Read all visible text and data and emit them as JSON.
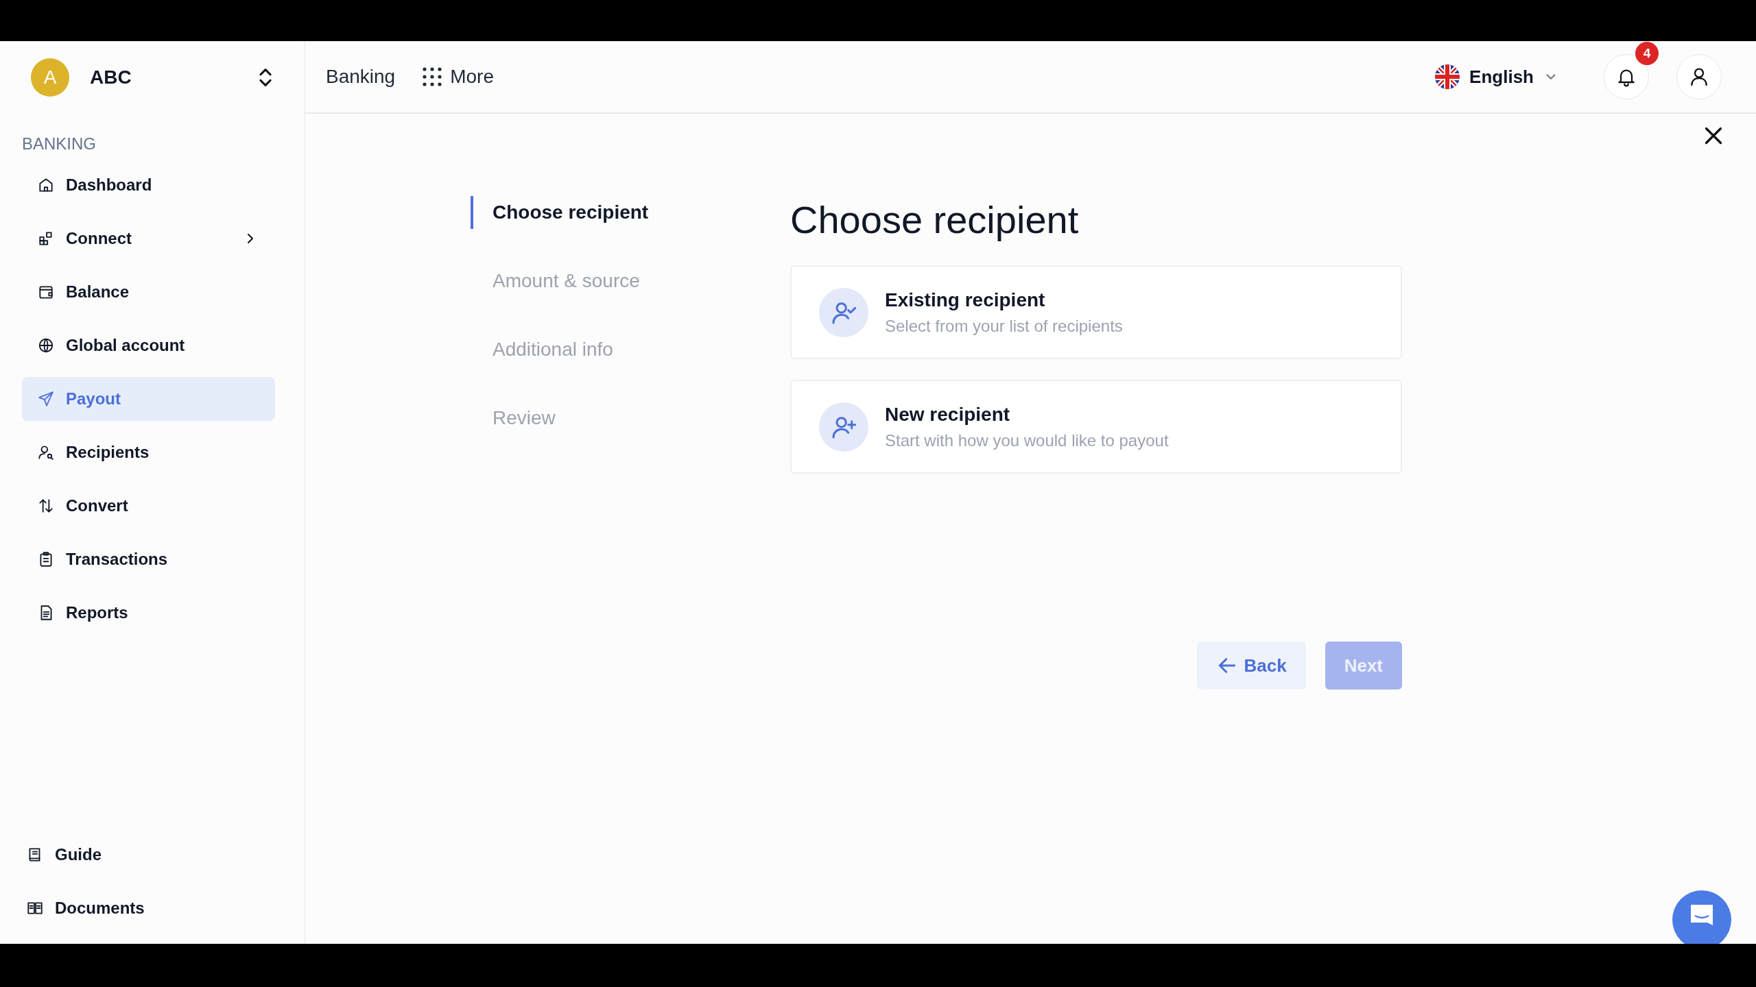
{
  "org": {
    "initial": "A",
    "name": "ABC"
  },
  "sidebar": {
    "section": "BANKING",
    "items": [
      {
        "label": "Dashboard",
        "kind": "link",
        "selected": false
      },
      {
        "label": "Connect",
        "kind": "group",
        "selected": false
      },
      {
        "label": "Balance",
        "kind": "link",
        "selected": false
      },
      {
        "label": "Global account",
        "kind": "link",
        "selected": false
      },
      {
        "label": "Payout",
        "kind": "link",
        "selected": true
      },
      {
        "label": "Recipients",
        "kind": "link",
        "selected": false
      },
      {
        "label": "Convert",
        "kind": "link",
        "selected": false
      },
      {
        "label": "Transactions",
        "kind": "link",
        "selected": false
      },
      {
        "label": "Reports",
        "kind": "link",
        "selected": false
      }
    ],
    "footer_items": [
      {
        "label": "Guide"
      },
      {
        "label": "Documents"
      }
    ]
  },
  "header": {
    "nav": [
      {
        "label": "Banking"
      },
      {
        "label": "More"
      }
    ],
    "language": "English",
    "notification_count": "4"
  },
  "steps": [
    {
      "label": "Choose recipient",
      "selected": true
    },
    {
      "label": "Amount & source",
      "selected": false
    },
    {
      "label": "Additional info",
      "selected": false
    },
    {
      "label": "Review",
      "selected": false
    }
  ],
  "title": "Choose recipient",
  "options": [
    {
      "title": "Existing recipient",
      "subtitle": "Select from your list of recipients"
    },
    {
      "title": "New recipient",
      "subtitle": "Start with how you would like to payout"
    }
  ],
  "buttons": [
    {
      "label": "Back",
      "disabled": false
    },
    {
      "label": "Next",
      "disabled": true
    }
  ]
}
